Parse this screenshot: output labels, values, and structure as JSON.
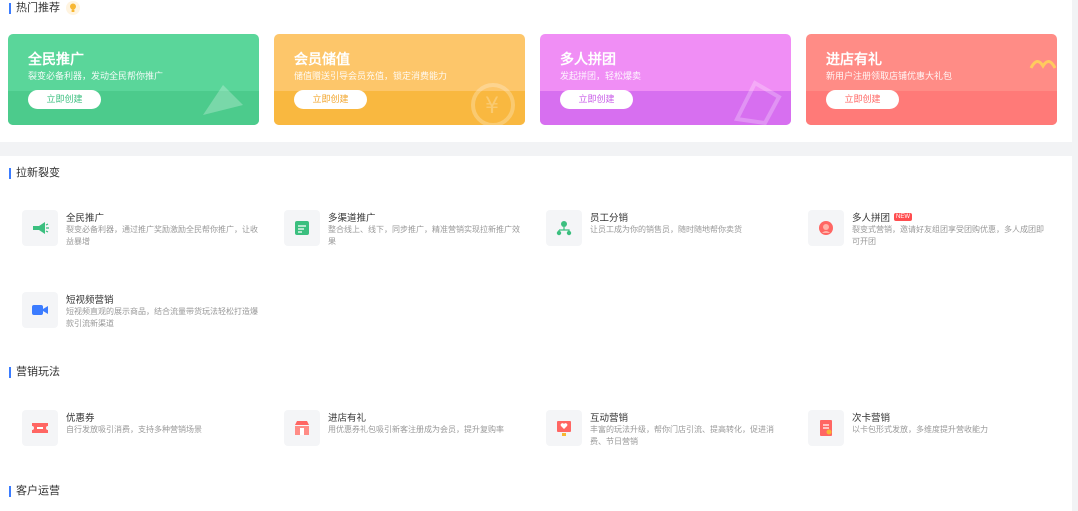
{
  "hot": {
    "title": "热门推荐",
    "cards": [
      {
        "title": "全民推广",
        "subtitle": "裂变必备利器，发动全民帮你推广",
        "button": "立即创建",
        "bg": "#5ad69a",
        "band": "#4ccb8c",
        "btn_color": "#3bbf7f"
      },
      {
        "title": "会员储值",
        "subtitle": "储值赠送引导会员充值，锁定消费能力",
        "button": "立即创建",
        "bg": "#fdc66a",
        "band": "#f9b840",
        "btn_color": "#f2a52b"
      },
      {
        "title": "多人拼团",
        "subtitle": "发起拼团，轻松爆卖",
        "button": "立即创建",
        "bg": "#f08ef5",
        "band": "#d76ff0",
        "btn_color": "#c85ae8"
      },
      {
        "title": "进店有礼",
        "subtitle": "新用户注册领取店铺优惠大礼包",
        "button": "立即创建",
        "bg": "#ff8c86",
        "band": "#ff7a78",
        "btn_color": "#ff6663"
      }
    ]
  },
  "sections": [
    {
      "title": "拉新裂变",
      "items": [
        {
          "name": "全民推广",
          "desc": "裂变必备利器，通过推广奖励激励全民帮你推广，让收益暴增",
          "icon": "megaphone-icon",
          "color": "#3bbf7f",
          "badge": ""
        },
        {
          "name": "多渠道推广",
          "desc": "整合线上、线下，同步推广，精准营销实现拉新推广效果",
          "icon": "channel-icon",
          "color": "#3bbf7f",
          "badge": ""
        },
        {
          "name": "员工分销",
          "desc": "让员工成为你的销售员，随时随地帮你卖货",
          "icon": "org-icon",
          "color": "#3bbf7f",
          "badge": ""
        },
        {
          "name": "多人拼团",
          "desc": "裂变式营销，邀请好友组团享受团购优惠，多人成团即可开团",
          "icon": "group-icon",
          "color": "#ff6663",
          "badge": "NEW"
        },
        {
          "name": "短视频营销",
          "desc": "短视频直观的展示商品，结合流量带货玩法轻松打造爆款引流新渠道",
          "icon": "video-icon",
          "color": "#3b7cff",
          "badge": ""
        }
      ]
    },
    {
      "title": "营销玩法",
      "items": [
        {
          "name": "优惠券",
          "desc": "自行发放吸引消费，支持多种营销场景",
          "icon": "coupon-icon",
          "color": "#ff6663",
          "badge": ""
        },
        {
          "name": "进店有礼",
          "desc": "用优惠券礼包吸引新客注册成为会员，提升复购率",
          "icon": "gift-shop-icon",
          "color": "#ff6663",
          "badge": ""
        },
        {
          "name": "互动营销",
          "desc": "丰富的玩法升级，帮你门店引流、提高转化，促进消费、节日营销",
          "icon": "interactive-icon",
          "color": "#ff6663",
          "badge": ""
        },
        {
          "name": "次卡营销",
          "desc": "以卡包形式发放，多维度提升营收能力",
          "icon": "card-icon",
          "color": "#ff6663",
          "badge": ""
        }
      ]
    },
    {
      "title": "客户运营",
      "items": []
    }
  ],
  "colors": {
    "accent": "#3b7cff",
    "text": "#333333",
    "muted": "#999999"
  }
}
